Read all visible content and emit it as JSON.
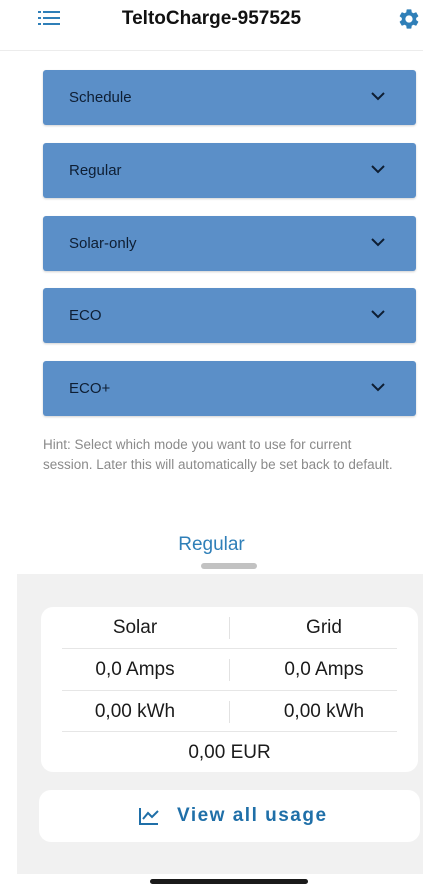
{
  "header": {
    "title": "TeltoCharge-957525",
    "menu_icon": "list-icon",
    "settings_icon": "gear-icon",
    "accent": "#2f7fb8"
  },
  "modes": [
    {
      "label": "Schedule"
    },
    {
      "label": "Regular"
    },
    {
      "label": "Solar-only"
    },
    {
      "label": "ECO"
    },
    {
      "label": "ECO+"
    }
  ],
  "mode_color": "#5b8fc8",
  "hint": "Hint: Select which mode you want to use for current session. Later this will automatically be set back to default.",
  "current_mode": "Regular",
  "stats": {
    "solar_header": "Solar",
    "grid_header": "Grid",
    "solar_current": "0,0 Amps",
    "grid_current": "0,0 Amps",
    "solar_energy": "0,00 kWh",
    "grid_energy": "0,00 kWh",
    "total_cost": "0,00 EUR"
  },
  "usage_button": {
    "label": "View all usage",
    "icon": "line-chart-icon"
  }
}
